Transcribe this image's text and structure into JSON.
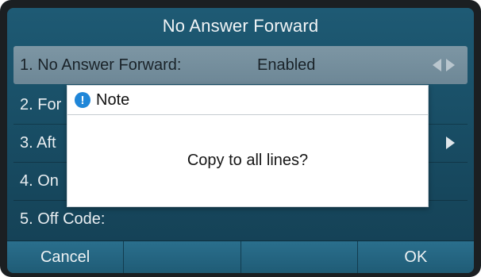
{
  "title": "No Answer Forward",
  "rows": [
    {
      "label": "1. No Answer Forward:",
      "value": "Enabled"
    },
    {
      "label": "2. For"
    },
    {
      "label": "3. Aft"
    },
    {
      "label": "4. On"
    },
    {
      "label": "5. Off Code:"
    }
  ],
  "dialog": {
    "icon": "info-icon",
    "icon_glyph": "!",
    "title": "Note",
    "message": "Copy to all lines?"
  },
  "softkeys": [
    "Cancel",
    "",
    "",
    "OK"
  ],
  "colors": {
    "screen": "#1b4f66",
    "highlight": "#7891a0",
    "softkey": "#245f7a",
    "dialog_bg": "#ffffff",
    "note_icon": "#1f86d8"
  }
}
